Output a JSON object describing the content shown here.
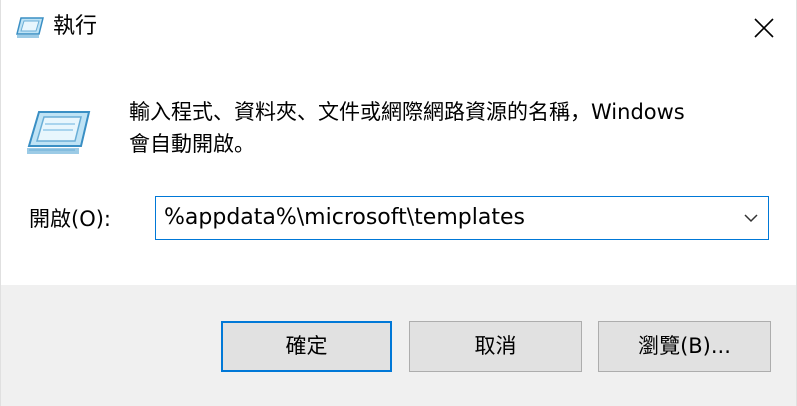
{
  "window": {
    "title": "執行"
  },
  "body": {
    "description_line1": "輸入程式、資料夾、文件或網際網路資源的名稱，Windows",
    "description_line2": "會自動開啟。",
    "open_label": "開啟(O):",
    "command_value": "%appdata%\\microsoft\\templates"
  },
  "buttons": {
    "ok": "確定",
    "cancel": "取消",
    "browse": "瀏覽(B)..."
  },
  "colors": {
    "accent": "#0078d7",
    "footer_bg": "#f0f0f0",
    "button_bg": "#e1e1e1"
  }
}
